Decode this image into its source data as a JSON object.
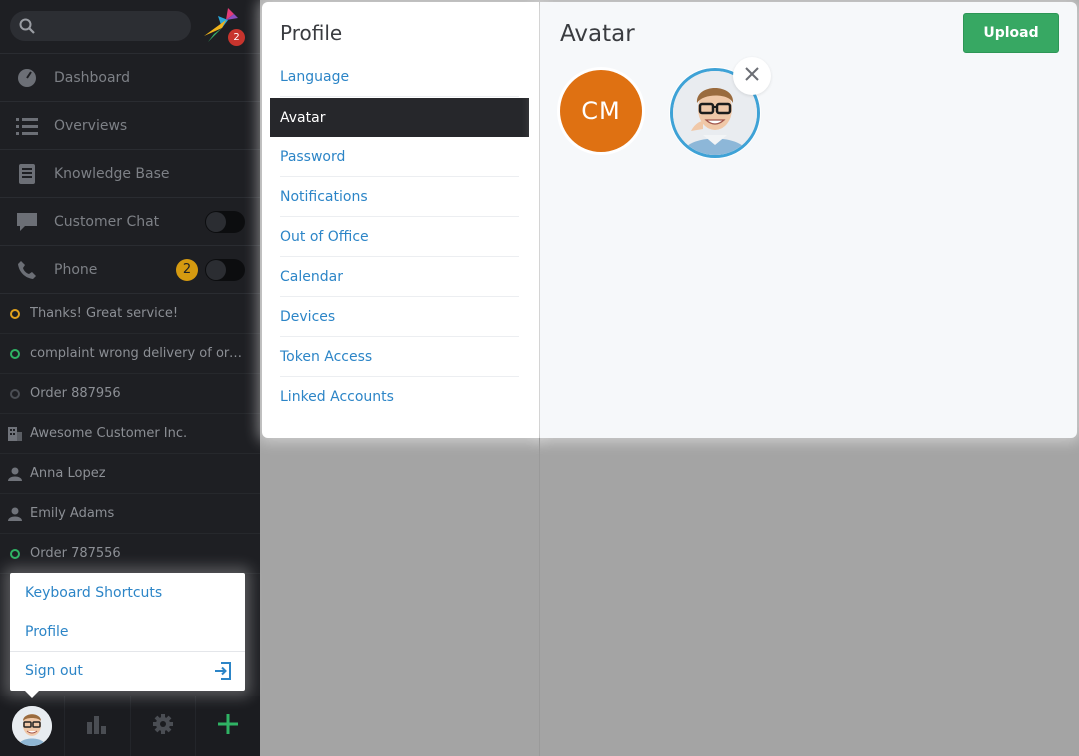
{
  "sidebar": {
    "logo_badge": "2",
    "nav": [
      {
        "label": "Dashboard",
        "icon": "dashboard-icon"
      },
      {
        "label": "Overviews",
        "icon": "list-icon"
      },
      {
        "label": "Knowledge Base",
        "icon": "book-icon"
      },
      {
        "label": "Customer Chat",
        "icon": "chat-icon",
        "toggle": "off"
      },
      {
        "label": "Phone",
        "icon": "phone-icon",
        "badge": "2",
        "toggle": "off"
      }
    ],
    "tasks": [
      {
        "label": "Thanks! Great service!",
        "icon": "ticket-status-open-icon",
        "color": "#e2a21d"
      },
      {
        "label": "complaint wrong delivery of order",
        "icon": "ticket-status-new-icon",
        "color": "#2fb364"
      },
      {
        "label": "Order 887956",
        "icon": "ticket-status-closed-icon",
        "color": "#4b4e54"
      },
      {
        "label": "Awesome Customer Inc.",
        "icon": "organization-icon",
        "color": "#70737a"
      },
      {
        "label": "Anna Lopez",
        "icon": "user-icon",
        "color": "#70737a"
      },
      {
        "label": "Emily Adams",
        "icon": "user-icon",
        "color": "#70737a"
      },
      {
        "label": "Order 787556",
        "icon": "ticket-status-new-icon",
        "color": "#2fb364"
      }
    ]
  },
  "user_menu": {
    "items": [
      "Keyboard Shortcuts",
      "Profile"
    ],
    "sign_out": "Sign out"
  },
  "profile_menu": {
    "title": "Profile",
    "items": [
      "Language",
      "Avatar",
      "Password",
      "Notifications",
      "Out of Office",
      "Calendar",
      "Devices",
      "Token Access",
      "Linked Accounts"
    ],
    "active": "Avatar"
  },
  "avatar_panel": {
    "title": "Avatar",
    "upload_label": "Upload",
    "initials": "CM"
  },
  "colors": {
    "accent_link": "#2c85c7",
    "upload_green": "#37a863",
    "initials_orange": "#df7112",
    "selected_ring": "#3ea2d6"
  }
}
